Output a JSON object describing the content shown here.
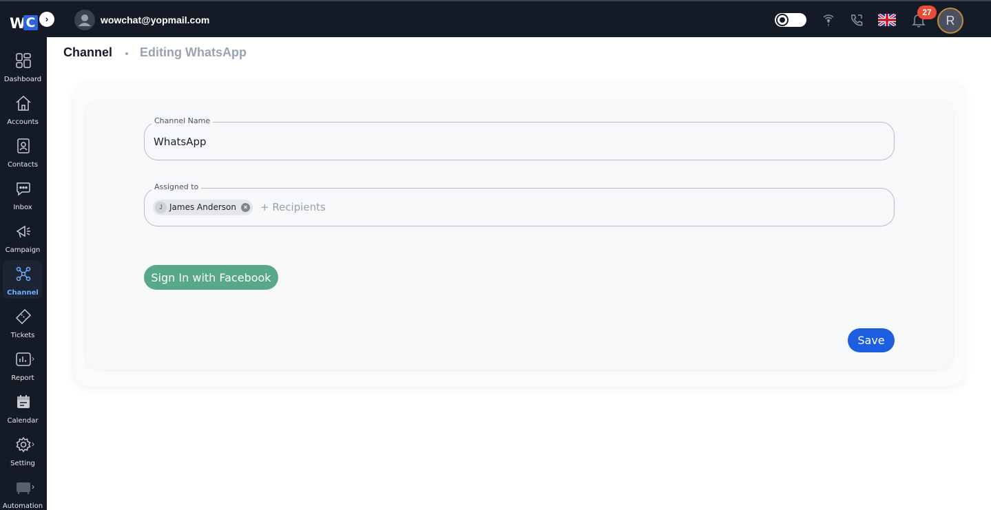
{
  "header": {
    "logo_w": "W",
    "logo_c": "C",
    "expand_glyph": "›",
    "user_email": "wowchat@yopmail.com",
    "notification_count": "27",
    "profile_initial": "R",
    "icons": [
      "theme-toggle",
      "broadcast-icon",
      "call-icon",
      "uk-flag-icon",
      "bell-icon"
    ]
  },
  "sidebar": {
    "items": [
      {
        "label": "Dashboard",
        "icon": "dashboard-icon"
      },
      {
        "label": "Accounts",
        "icon": "home-icon"
      },
      {
        "label": "Contacts",
        "icon": "contacts-icon"
      },
      {
        "label": "Inbox",
        "icon": "chat-icon"
      },
      {
        "label": "Campaign",
        "icon": "megaphone-icon"
      },
      {
        "label": "Channel",
        "icon": "network-icon",
        "active": true
      },
      {
        "label": "Tickets",
        "icon": "ticket-icon"
      },
      {
        "label": "Report",
        "icon": "report-icon"
      },
      {
        "label": "Calendar",
        "icon": "calendar-icon"
      },
      {
        "label": "Setting",
        "icon": "gear-icon"
      },
      {
        "label": "Automation",
        "icon": "automation-icon"
      }
    ],
    "chevron_glyph": "›"
  },
  "breadcrumb": {
    "main": "Channel",
    "sub": "Editing WhatsApp"
  },
  "form": {
    "channel_name_label": "Channel Name",
    "channel_name_value": "WhatsApp",
    "assigned_to_label": "Assigned to",
    "assigned_chip_initial": "J",
    "assigned_chip_name": "James Anderson",
    "chip_remove_glyph": "×",
    "recipients_placeholder": "+ Recipients",
    "facebook_button": "Sign In with Facebook",
    "save_button": "Save"
  },
  "colors": {
    "topbar": "#151b26",
    "accent_blue": "#1d5ee0",
    "facebook_green": "#58a88a",
    "active_nav": "#6fb0ff",
    "badge_red": "#ea4c3a"
  }
}
